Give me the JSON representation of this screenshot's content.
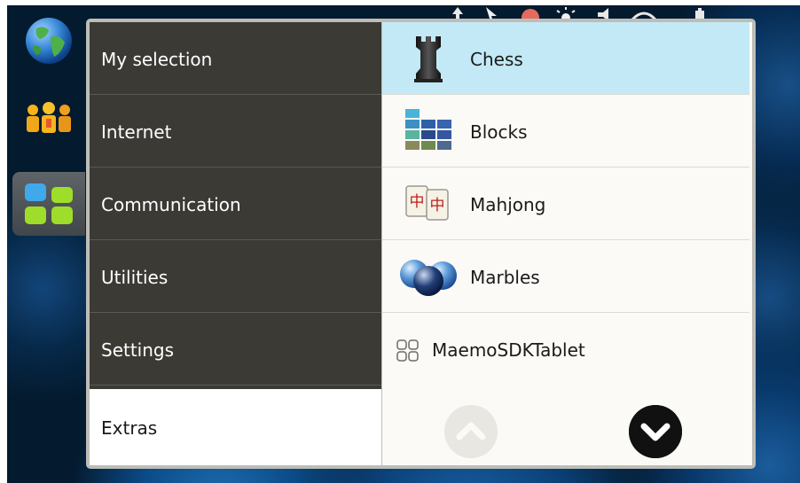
{
  "colors": {
    "category_bg": "#3b3a35",
    "category_selected_bg": "#ffffff",
    "app_panel_bg": "#fcfaf6",
    "app_selected_bg": "#c3e9f6",
    "menu_frame": "#bdbdb7"
  },
  "launcher": {
    "items": [
      {
        "icon": "web-globe-icon",
        "active": false
      },
      {
        "icon": "contacts-people-icon",
        "active": false
      },
      {
        "icon": "application-menu-icon",
        "active": true
      }
    ]
  },
  "status_icons": [
    "upload-icon",
    "cursor-icon",
    "presence-icon",
    "brightness-icon",
    "volume-icon",
    "connectivity-icon",
    "battery-icon"
  ],
  "menu": {
    "categories": [
      {
        "label": "My selection",
        "selected": false
      },
      {
        "label": "Internet",
        "selected": false
      },
      {
        "label": "Communication",
        "selected": false
      },
      {
        "label": "Utilities",
        "selected": false
      },
      {
        "label": "Settings",
        "selected": false
      },
      {
        "label": "Extras",
        "selected": true
      }
    ],
    "apps": [
      {
        "label": "Chess",
        "icon": "chess-rook-icon",
        "selected": true
      },
      {
        "label": "Blocks",
        "icon": "blocks-icon",
        "selected": false
      },
      {
        "label": "Mahjong",
        "icon": "mahjong-tiles-icon",
        "selected": false
      },
      {
        "label": "Marbles",
        "icon": "marbles-icon",
        "selected": false
      },
      {
        "label": "MaemoSDKTablet",
        "icon": "generic-app-icon",
        "selected": false
      }
    ],
    "scroll": {
      "up_icon": "scroll-up-icon",
      "down_icon": "scroll-down-icon",
      "up_enabled": false,
      "down_enabled": true
    }
  }
}
